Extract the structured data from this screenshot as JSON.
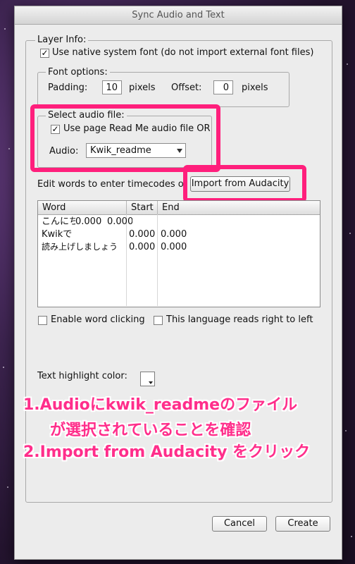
{
  "window": {
    "title": "Sync Audio and Text"
  },
  "layer_info": {
    "legend": "Layer Info:",
    "native_font_label": "Use native system font (do not import external font files)",
    "native_font_checked": true
  },
  "font_options": {
    "legend": "Font options:",
    "padding_label": "Padding:",
    "padding_value": "10",
    "padding_unit": "pixels",
    "offset_label": "Offset:",
    "offset_value": "0",
    "offset_unit": "pixels"
  },
  "audio_file": {
    "legend": "Select audio file:",
    "use_readme_label": "Use page Read Me audio file  OR",
    "use_readme_checked": true,
    "audio_label": "Audio:",
    "audio_selected": "Kwik_readme"
  },
  "timecodes": {
    "instruction": "Edit words to enter timecodes o",
    "import_button": "Import from Audacity"
  },
  "table": {
    "columns": [
      "Word",
      "Start",
      "End"
    ],
    "rows": [
      {
        "word": "こんにちは",
        "start": "0.000",
        "end": "0.000",
        "overlapped": true
      },
      {
        "word": "Kwikで",
        "start": "0.000",
        "end": "0.000"
      },
      {
        "word": "読み上げしましょう",
        "start": "0.000",
        "end": "0.000"
      }
    ]
  },
  "options": {
    "word_clicking_label": "Enable word clicking",
    "word_clicking_checked": false,
    "rtl_label": "This language reads right to left",
    "rtl_checked": false
  },
  "highlight": {
    "label": "Text highlight color:",
    "color": "#ffffff"
  },
  "annotation": {
    "line1": "1.Audioにkwik_readmeのファイル",
    "line2": "が選択されていることを確認",
    "line3": "2.Import from Audacity をクリック",
    "color": "#ff2e8b"
  },
  "footer": {
    "cancel": "Cancel",
    "create": "Create"
  },
  "colors": {
    "highlight_box": "#ff1f7c",
    "dialog_bg": "#ececec"
  }
}
